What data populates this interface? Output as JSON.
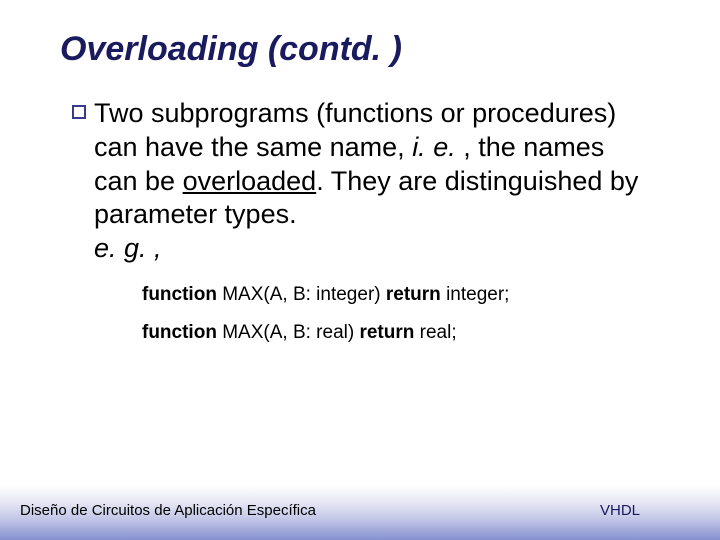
{
  "title": "Overloading (contd. )",
  "bullet": {
    "part1": "Two subprograms (functions or procedures) can have the same name, ",
    "ie": "i. e. ",
    "part2": ", the names can be ",
    "overloaded": "overloaded",
    "part3": ". They are distinguished by parameter types. ",
    "eg": "e. g. ,"
  },
  "code1": {
    "kw1": "function",
    "mid": " MAX(A, B: integer) ",
    "kw2": "return",
    "end": " integer;"
  },
  "code2": {
    "kw1": "function",
    "mid": " MAX(A, B: real) ",
    "kw2": "return",
    "end": " real;"
  },
  "footer": {
    "left": "Diseño de Circuitos de Aplicación Específica",
    "right": "VHDL"
  }
}
